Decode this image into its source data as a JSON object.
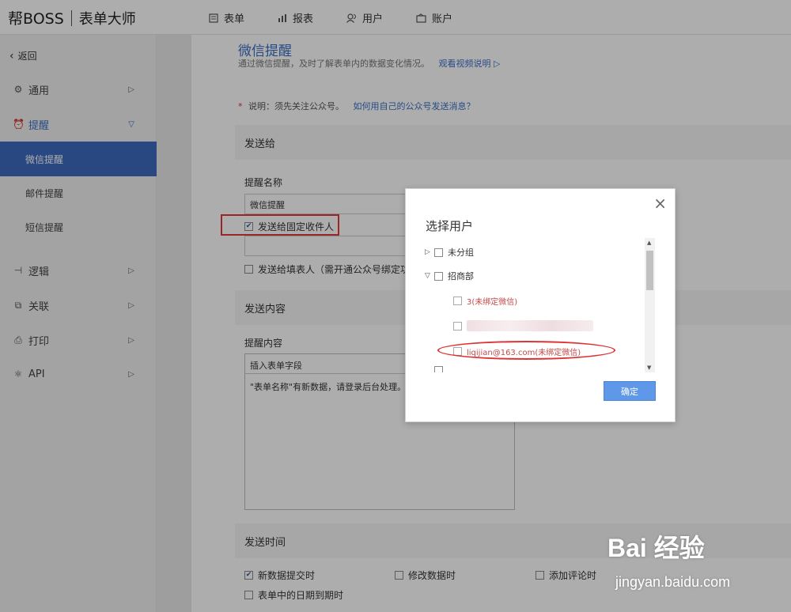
{
  "brand": {
    "name": "帮BOSS",
    "product": "表单大师"
  },
  "topnav": [
    {
      "label": "表单",
      "icon": "form-icon"
    },
    {
      "label": "报表",
      "icon": "chart-icon"
    },
    {
      "label": "用户",
      "icon": "user-icon"
    },
    {
      "label": "账户",
      "icon": "account-icon"
    }
  ],
  "sidebar": {
    "back_label": "返回",
    "items": [
      {
        "label": "通用",
        "icon": "gear-icon"
      },
      {
        "label": "提醒",
        "icon": "alarm-icon"
      },
      {
        "label": "逻辑",
        "icon": "logic-icon"
      },
      {
        "label": "关联",
        "icon": "link-icon"
      },
      {
        "label": "打印",
        "icon": "print-icon"
      },
      {
        "label": "API",
        "icon": "api-icon"
      }
    ],
    "sub_items": [
      "微信提醒",
      "邮件提醒",
      "短信提醒"
    ]
  },
  "main": {
    "title": "微信提醒",
    "desc": "通过微信提醒，及时了解表单内的数据变化情况。",
    "video_link": "观看视频说明",
    "note_star": "*",
    "note": "说明：须先关注公众号。",
    "note_link": "如何用自己的公众号发送消息？",
    "send_to": {
      "section": "发送给",
      "name_label": "提醒名称",
      "name_value": "微信提醒",
      "fixed_label": "发送给固定收件人",
      "filler_label": "发送给填表人（需开通公众号绑定功"
    },
    "content": {
      "section": "发送内容",
      "label": "提醒内容",
      "insert_field": "插入表单字段",
      "body": "\"表单名称\"有新数据，请登录后台处理。"
    },
    "time": {
      "section": "发送时间",
      "options": [
        "新数据提交时",
        "修改数据时",
        "添加评论时",
        "表单中的日期到期时"
      ]
    }
  },
  "modal": {
    "close": "×",
    "title": "选择用户",
    "tree": {
      "group1": "未分组",
      "group2": "招商部",
      "user1": "3(未绑定微信)",
      "user3": "liqijian@163.com(未绑定微信)"
    },
    "ok": "确定"
  },
  "watermark": {
    "logo": "Bai  经验",
    "url": "jingyan.baidu.com"
  }
}
